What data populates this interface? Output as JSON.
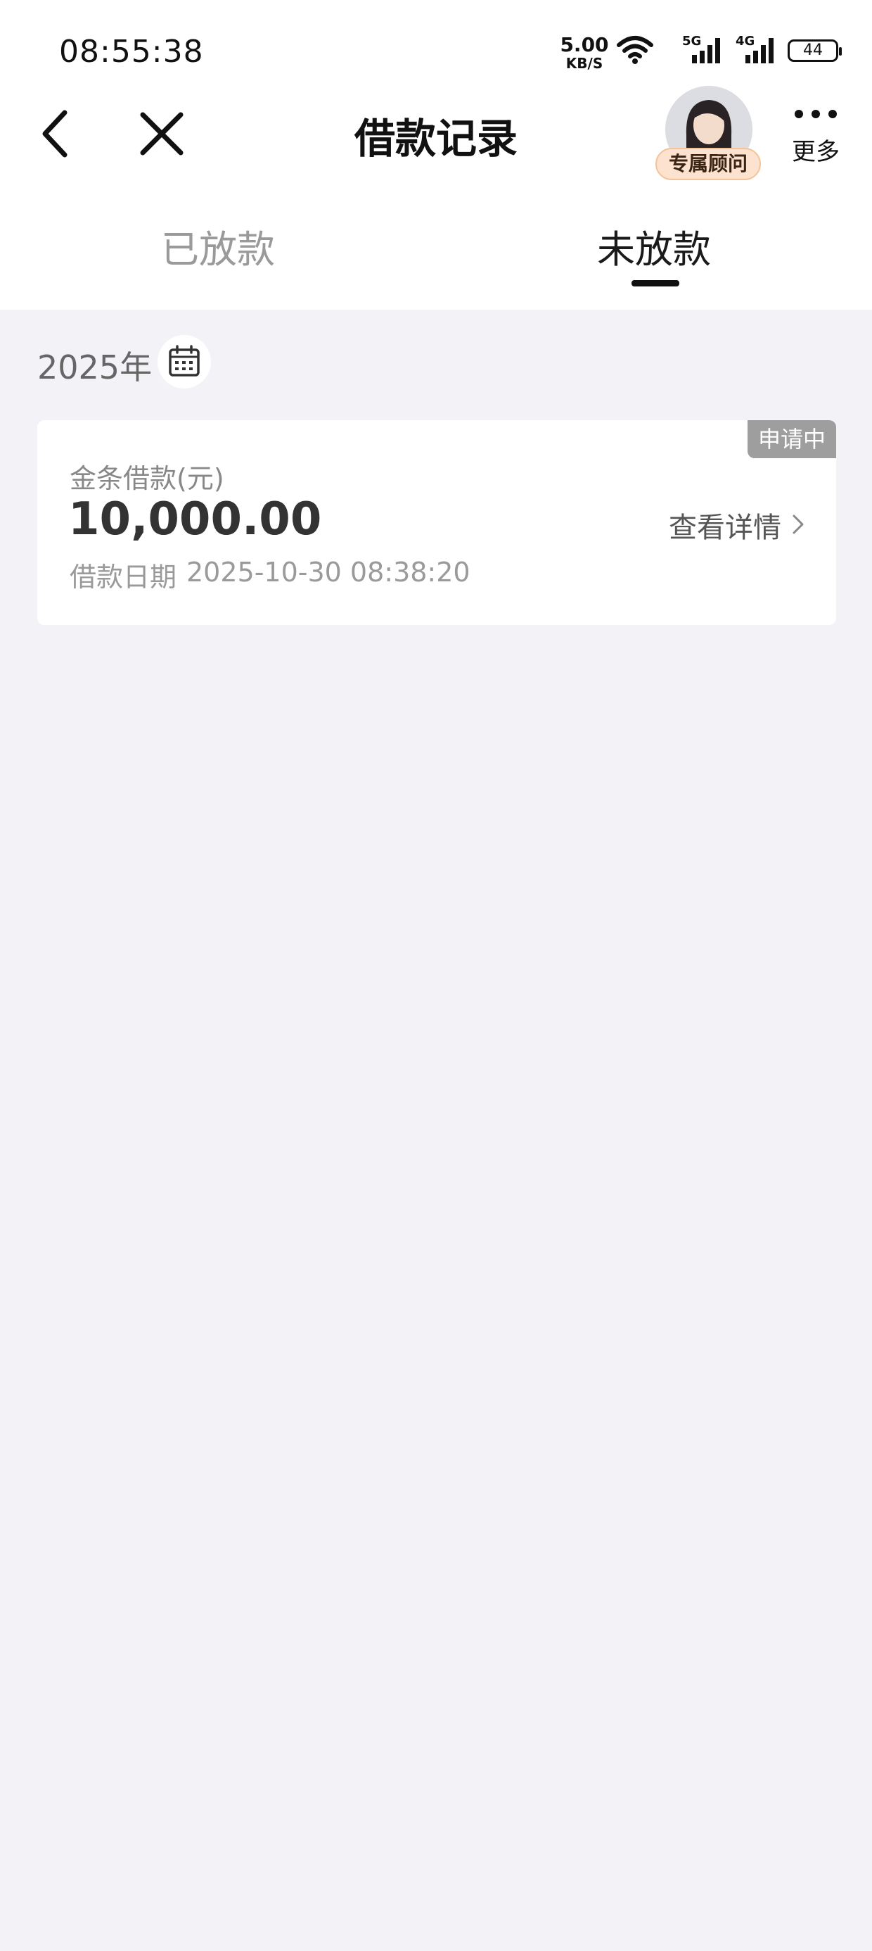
{
  "status_bar": {
    "time": "08:55:38",
    "net_speed_value": "5.00",
    "net_speed_unit": "KB/S",
    "signal_1_tag": "5G",
    "signal_2_tag": "4G",
    "battery": "44"
  },
  "nav": {
    "title": "借款记录",
    "advisor_label": "专属顾问",
    "more_label": "更多"
  },
  "tabs": [
    {
      "label": "已放款",
      "selected": false
    },
    {
      "label": "未放款",
      "selected": true
    }
  ],
  "filter": {
    "year": "2025年"
  },
  "records": [
    {
      "status": "申请中",
      "label": "金条借款(元)",
      "amount": "10,000.00",
      "date_label": "借款日期",
      "date": "2025-10-30 08:38:20",
      "detail_label": "查看详情"
    }
  ],
  "colors": {
    "background": "#f2f2f7",
    "status_badge": "#9e9e9e",
    "advisor_badge": "#fde3cf"
  }
}
